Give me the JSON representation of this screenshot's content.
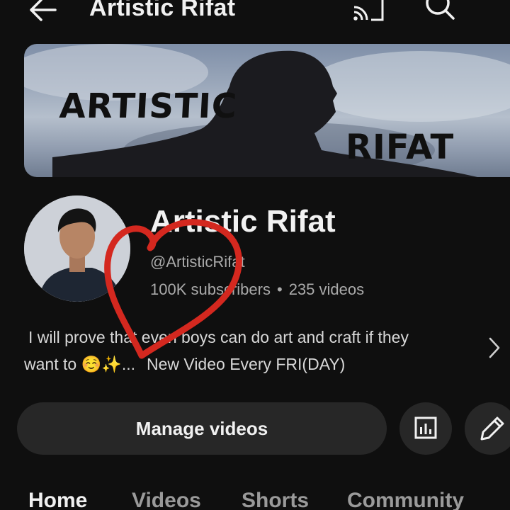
{
  "header": {
    "title": "Artistic Rifat",
    "icons": [
      "back-arrow-icon",
      "cast-icon",
      "search-icon"
    ]
  },
  "banner": {
    "text_line1": "ARTISTIC",
    "text_line2": "RIFAT"
  },
  "channel": {
    "name": "Artistic Rifat",
    "handle": "@ArtisticRifat",
    "subscribers": "100K subscribers",
    "separator": "•",
    "videos": "235 videos",
    "description_line1": "I will prove that even boys can do art and craft if they",
    "description_line2": "want to ☺️✨...",
    "description_more": "New Video Every FRI(DAY)"
  },
  "actions": {
    "manage_label": "Manage videos",
    "analytics_icon": "analytics-icon",
    "edit_icon": "pencil-icon"
  },
  "tabs": [
    {
      "label": "Home",
      "active": true
    },
    {
      "label": "Videos",
      "active": false
    },
    {
      "label": "Shorts",
      "active": false
    },
    {
      "label": "Community",
      "active": false
    }
  ],
  "colors": {
    "background": "#0f0f0f",
    "button_bg": "#272727",
    "secondary_text": "#aaaaaa",
    "heart_annotation": "#d4281f"
  }
}
